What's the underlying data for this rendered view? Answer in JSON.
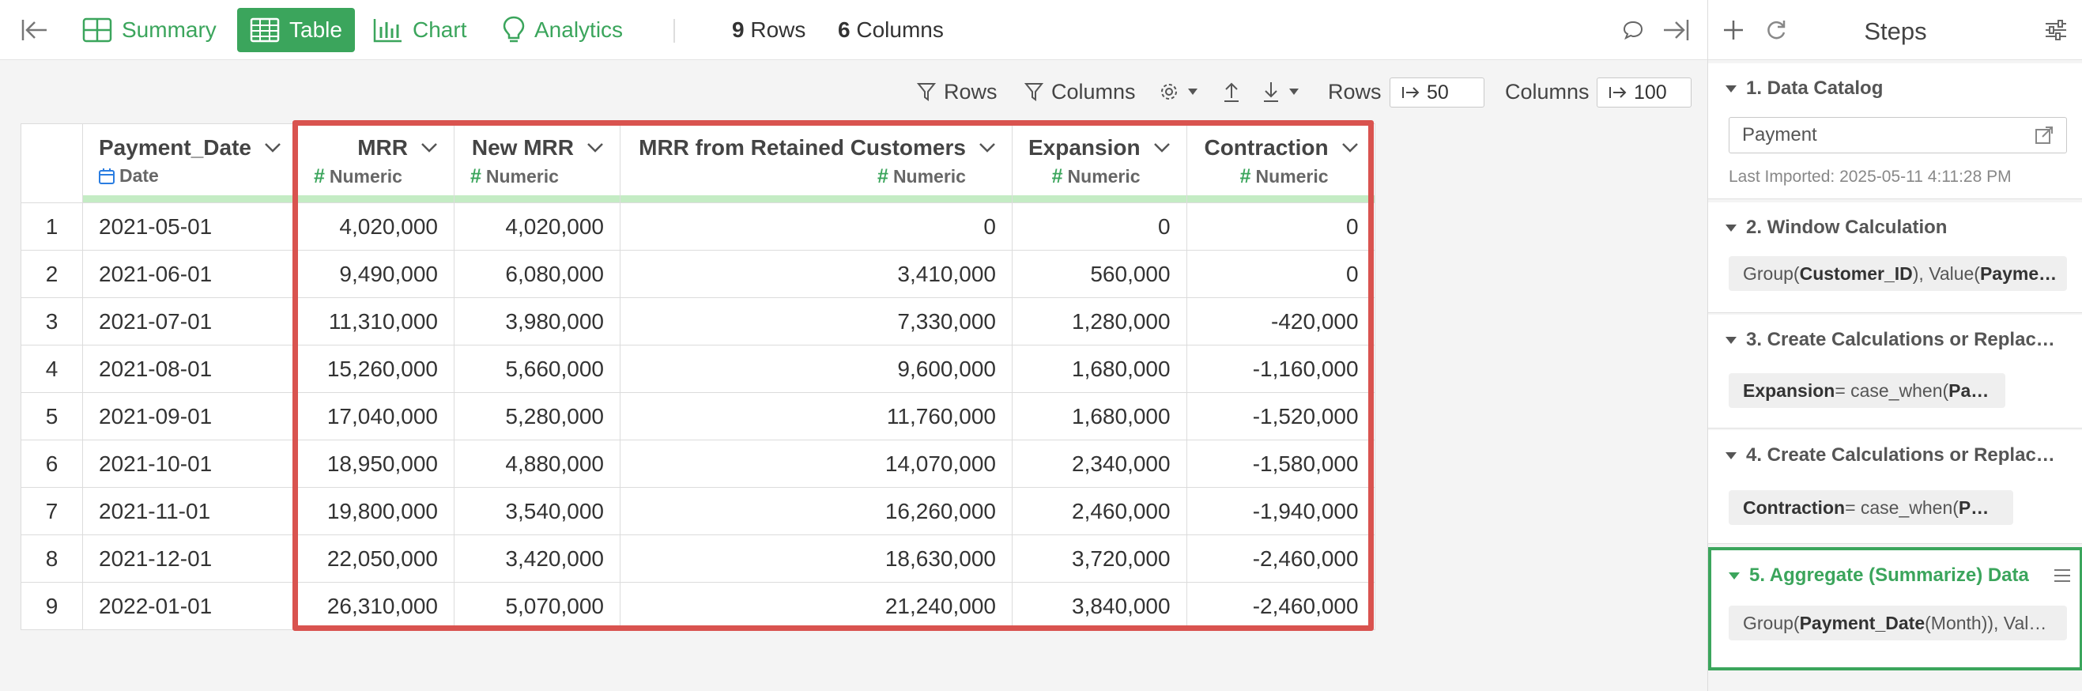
{
  "toolbar": {
    "collapse_icon": "collapse-left-icon",
    "tabs": [
      {
        "label": "Summary",
        "icon": "summary-icon",
        "active": false
      },
      {
        "label": "Table",
        "icon": "table-icon",
        "active": true
      },
      {
        "label": "Chart",
        "icon": "chart-icon",
        "active": false
      },
      {
        "label": "Analytics",
        "icon": "lightbulb-icon",
        "active": false
      }
    ],
    "rows_count": "9",
    "rows_label": "Rows",
    "columns_count": "6",
    "columns_label": "Columns",
    "comment_icon": "comment-icon",
    "expand_icon": "expand-right-icon"
  },
  "subbar": {
    "rows_filter": "Rows",
    "columns_filter": "Columns",
    "rows_label": "Rows",
    "rows_value": "50",
    "columns_label": "Columns",
    "columns_value": "100"
  },
  "table": {
    "columns": [
      {
        "name": "Payment_Date",
        "type": "Date",
        "numeric": false
      },
      {
        "name": "MRR",
        "type": "Numeric",
        "numeric": true
      },
      {
        "name": "New MRR",
        "type": "Numeric",
        "numeric": true
      },
      {
        "name": "MRR from Retained Customers",
        "type": "Numeric",
        "numeric": true
      },
      {
        "name": "Expansion",
        "type": "Numeric",
        "numeric": true
      },
      {
        "name": "Contraction",
        "type": "Numeric",
        "numeric": true
      }
    ],
    "rows": [
      [
        "1",
        "2021-05-01",
        "4,020,000",
        "4,020,000",
        "0",
        "0",
        "0"
      ],
      [
        "2",
        "2021-06-01",
        "9,490,000",
        "6,080,000",
        "3,410,000",
        "560,000",
        "0"
      ],
      [
        "3",
        "2021-07-01",
        "11,310,000",
        "3,980,000",
        "7,330,000",
        "1,280,000",
        "-420,000"
      ],
      [
        "4",
        "2021-08-01",
        "15,260,000",
        "5,660,000",
        "9,600,000",
        "1,680,000",
        "-1,160,000"
      ],
      [
        "5",
        "2021-09-01",
        "17,040,000",
        "5,280,000",
        "11,760,000",
        "1,680,000",
        "-1,520,000"
      ],
      [
        "6",
        "2021-10-01",
        "18,950,000",
        "4,880,000",
        "14,070,000",
        "2,340,000",
        "-1,580,000"
      ],
      [
        "7",
        "2021-11-01",
        "19,800,000",
        "3,540,000",
        "16,260,000",
        "2,460,000",
        "-1,940,000"
      ],
      [
        "8",
        "2021-12-01",
        "22,050,000",
        "3,420,000",
        "18,630,000",
        "3,720,000",
        "-2,460,000"
      ],
      [
        "9",
        "2022-01-01",
        "26,310,000",
        "5,070,000",
        "21,240,000",
        "3,840,000",
        "-2,460,000"
      ]
    ]
  },
  "steps_panel": {
    "title": "Steps",
    "steps": [
      {
        "title": "1. Data Catalog",
        "input_value": "Payment",
        "meta": "Last Imported: 2025-05-11 4:11:28 PM"
      },
      {
        "title": "2. Window Calculation",
        "pill_pre": "Group(",
        "pill_b1": "Customer_ID",
        "pill_mid": "), Value(",
        "pill_b2": "Payme…"
      },
      {
        "title": "3. Create Calculations or Replac…",
        "pill_b1": "Expansion",
        "pill_mid": " = case_when(",
        "pill_b2": "Pa…"
      },
      {
        "title": "4. Create Calculations or Replac…",
        "pill_b1": "Contraction",
        "pill_mid": " = case_when(",
        "pill_b2": "P…"
      },
      {
        "title": "5. Aggregate (Summarize) Data",
        "pill_pre": "Group(",
        "pill_b1": "Payment_Date",
        "pill_mid": " (Month)), Val…",
        "active": true
      }
    ]
  },
  "colors": {
    "accent": "#3ba55c",
    "highlight": "#d9534f",
    "type_bar": "#c4ecc4"
  }
}
